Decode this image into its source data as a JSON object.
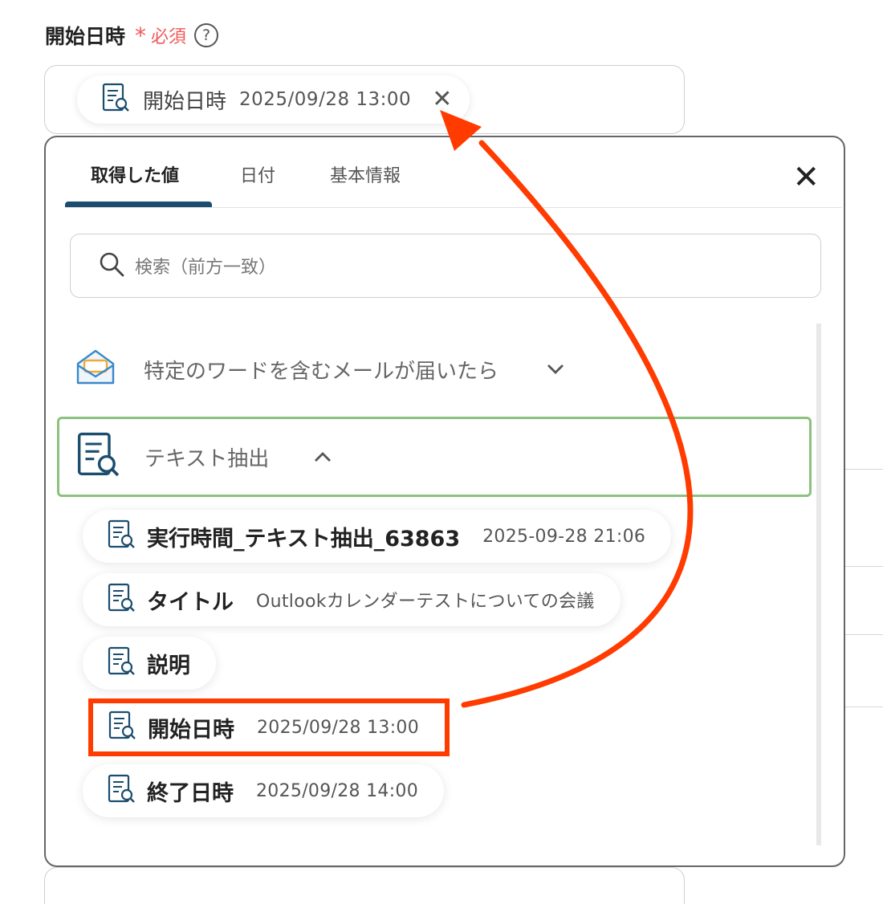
{
  "field": {
    "label": "開始日時",
    "required_mark": "*",
    "required_text": "必須",
    "help_icon": "?"
  },
  "selected_value": {
    "name": "開始日時",
    "value": "2025/09/28 13:00",
    "remove_icon": "✕"
  },
  "panel": {
    "tabs": [
      "取得した値",
      "日付",
      "基本情報"
    ],
    "active_tab_index": 0,
    "close_icon": "✕",
    "search_placeholder": "検索（前方一致）",
    "groups": {
      "mail": {
        "name": "特定のワードを含むメールが届いたら",
        "chevron": "⌄"
      },
      "text": {
        "name": "テキスト抽出",
        "chevron": "⌃"
      }
    },
    "items": [
      {
        "name": "実行時間_テキスト抽出_63863",
        "value": "2025-09-28 21:06"
      },
      {
        "name": "タイトル",
        "value": "Outlookカレンダーテストについての会議"
      },
      {
        "name": "説明",
        "value": ""
      },
      {
        "name": "開始日時",
        "value": "2025/09/28 13:00"
      },
      {
        "name": "終了日時",
        "value": "2025/09/28 14:00"
      }
    ]
  },
  "colors": {
    "accent": "#1b4d6e",
    "required": "#f05a5a",
    "group_border": "#8cc17f",
    "highlight": "#ff3b00"
  }
}
